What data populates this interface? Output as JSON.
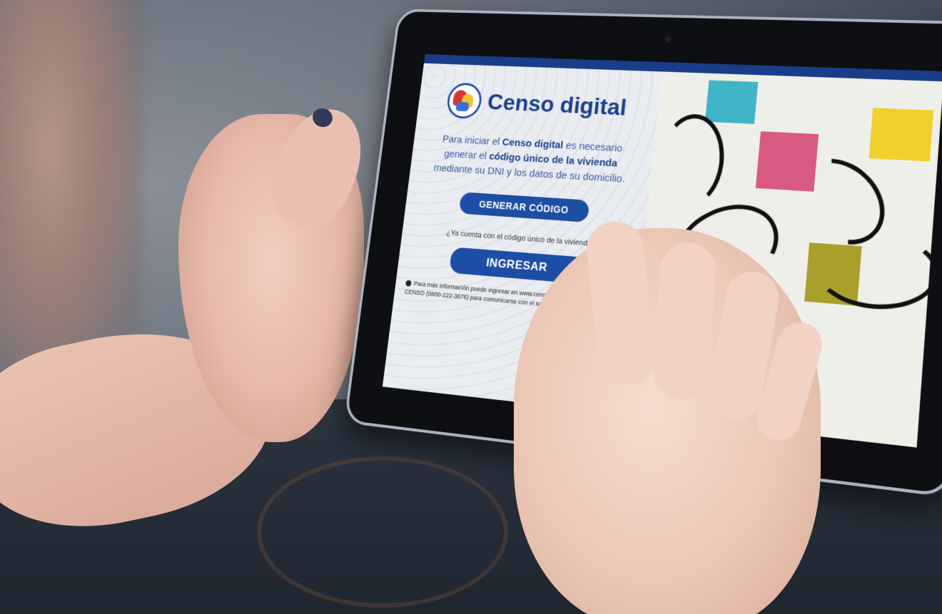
{
  "app": {
    "title": "Censo digital",
    "intro_part1": "Para iniciar el ",
    "intro_bold1": "Censo digital",
    "intro_part2": " es necesario generar el ",
    "intro_bold2": "código único de la vivienda",
    "intro_part3": " mediante su DNI y los datos de su domicilio.",
    "generate_button": "GENERAR CÓDIGO",
    "question": "¿Ya cuenta con el código único de la vivienda?",
    "login_button": "INGRESAR",
    "info_text": "Para más información puede ingresar en www.censo.gob.ar o llamar al 0800-22-CENSO (0800-222-3676) para comunicarse con el servicio gratuito de la ayuda."
  },
  "colors": {
    "brand_blue": "#1d4ea6",
    "status_bar": "#1a3d8a",
    "art_cyan": "#3fb6c8",
    "art_pink": "#d65a82",
    "art_yellow": "#f0d02a",
    "art_olive": "#a8a02a"
  },
  "icons": [
    "census-logo-icon",
    "info-icon"
  ]
}
